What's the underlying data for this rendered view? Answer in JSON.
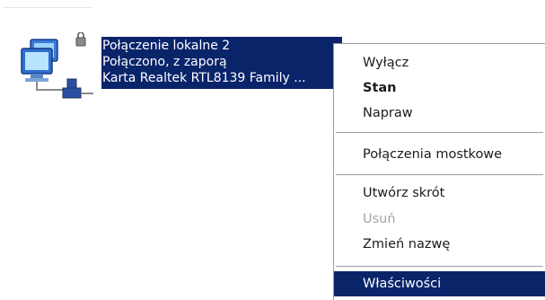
{
  "connection": {
    "name": "Połączenie lokalne 2",
    "status": "Połączono, z zaporą",
    "device": "Karta Realtek RTL8139 Family ...",
    "icon": "network-connection-icon",
    "selection_color": "#0a246a"
  },
  "context_menu": {
    "items": [
      {
        "label": "Wyłącz"
      },
      {
        "label": "Stan"
      },
      {
        "label": "Napraw"
      },
      {
        "label": "Połączenia mostkowe"
      },
      {
        "label": "Utwórz skrót"
      },
      {
        "label": "Usuń"
      },
      {
        "label": "Zmień nazwę"
      },
      {
        "label": "Właściwości"
      }
    ]
  }
}
